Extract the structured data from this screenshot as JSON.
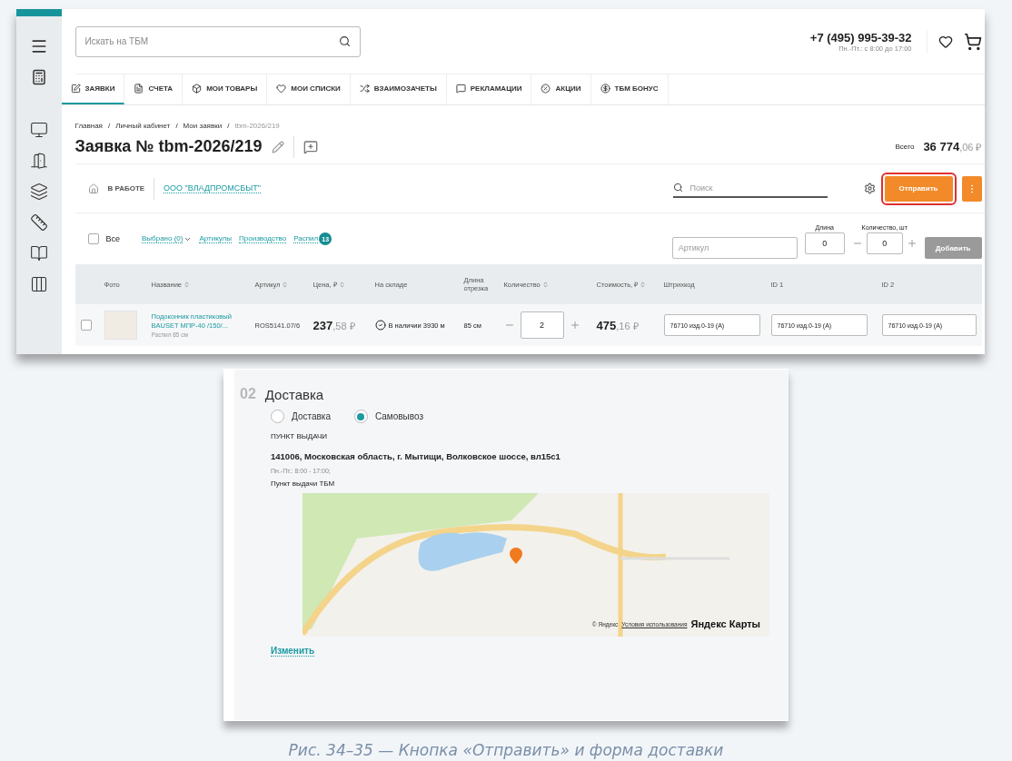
{
  "order_screen": {
    "search": {
      "placeholder": "Искать на ТБМ"
    },
    "phone": "+7 (495) 995-39-32",
    "hours": "Пн.-Пт.: с 8:00 до 17:00",
    "tabs": [
      {
        "label": "ЗАЯВКИ",
        "selected": true
      },
      {
        "label": "СЧЕТА",
        "selected": false
      },
      {
        "label": "МОИ ТОВАРЫ",
        "selected": false
      },
      {
        "label": "МОИ СПИСКИ",
        "selected": false
      },
      {
        "label": "ВЗАИМОЗАЧЕТЫ",
        "selected": false
      },
      {
        "label": "РЕКЛАМАЦИИ",
        "selected": false
      },
      {
        "label": "АКЦИИ",
        "selected": false
      },
      {
        "label": "ТБМ БОНУС",
        "selected": false
      }
    ],
    "breadcrumbs": [
      "Главная",
      "Личный кабинет",
      "Мои заявки",
      "tbm-2026/219"
    ],
    "breadcrumb_separator": "/",
    "title": "Заявка № tbm-2026/219",
    "total": {
      "label": "Всего",
      "whole": "36 774",
      "fraction": ",06 ₽"
    },
    "status": "В РАБОТЕ",
    "company": "ООО \"ВЛАДПРОМСБЫТ\"",
    "search_field": {
      "placeholder": "Поиск"
    },
    "send_button": {
      "label": "Отправить",
      "highlighted": true
    },
    "filters": {
      "all_label": "Все",
      "all_checked": false,
      "links": [
        "Выбрано (0)",
        "Артикулы",
        "Производство",
        "Распил"
      ],
      "count": "13"
    },
    "add_form": {
      "article_placeholder": "Артикул",
      "length_label": "Длина",
      "length_value": "0",
      "qty_label": "Количество, шт",
      "qty_value": "0",
      "add_button": "Добавить",
      "add_disabled": true
    },
    "table": {
      "columns": [
        {
          "label": "Фото",
          "sortable": false
        },
        {
          "label": "Название",
          "sortable": true
        },
        {
          "label": "Артикул",
          "sortable": true
        },
        {
          "label": "Цена, ₽",
          "sortable": true
        },
        {
          "label": "На складе",
          "sortable": false
        },
        {
          "label": "Длина отрезка",
          "sortable": false
        },
        {
          "label": "Количество",
          "sortable": true
        },
        {
          "label": "Стоимость, ₽",
          "sortable": true
        },
        {
          "label": "Штрихкод",
          "sortable": false
        },
        {
          "label": "ID 1",
          "sortable": false
        },
        {
          "label": "ID 2",
          "sortable": false
        }
      ],
      "rows": [
        {
          "checked": false,
          "name": "Подоконник пластиковый BAUSET МПР-40 /150/...",
          "note": "Распил 85 см",
          "article": "ROS5141.07/6",
          "price_whole": "237",
          "price_fraction": ",58 ₽",
          "stock": "В наличии 3930 м",
          "length": "85 см",
          "quantity": "2",
          "cost_whole": "475",
          "cost_fraction": ",16 ₽",
          "barcode": "76710  изд.0-19 (А)",
          "id1": "76710  изд.0-19 (А)",
          "id2": "76710  изд.0-19 (А)"
        }
      ]
    }
  },
  "delivery_screen": {
    "step": "02",
    "heading": "Доставка",
    "options": [
      {
        "label": "Доставка",
        "selected": false
      },
      {
        "label": "Самовывоз",
        "selected": true
      }
    ],
    "point_label": "ПУНКТ ВЫДАЧИ",
    "address": "141006, Московская область, г. Мытищи, Волковское шоссе, вл15с1",
    "hours": "Пн.-Пт.: 8:00 - 17:00;",
    "point_name": "Пункт выдачи ТБМ",
    "map": {
      "copyright": "© Яндекс",
      "terms": "Условия использования",
      "brand": "Яндекс Карты"
    },
    "change_link": "Изменить"
  },
  "caption": "Рис. 34–35 — Кнопка «Отправить» и форма доставки"
}
